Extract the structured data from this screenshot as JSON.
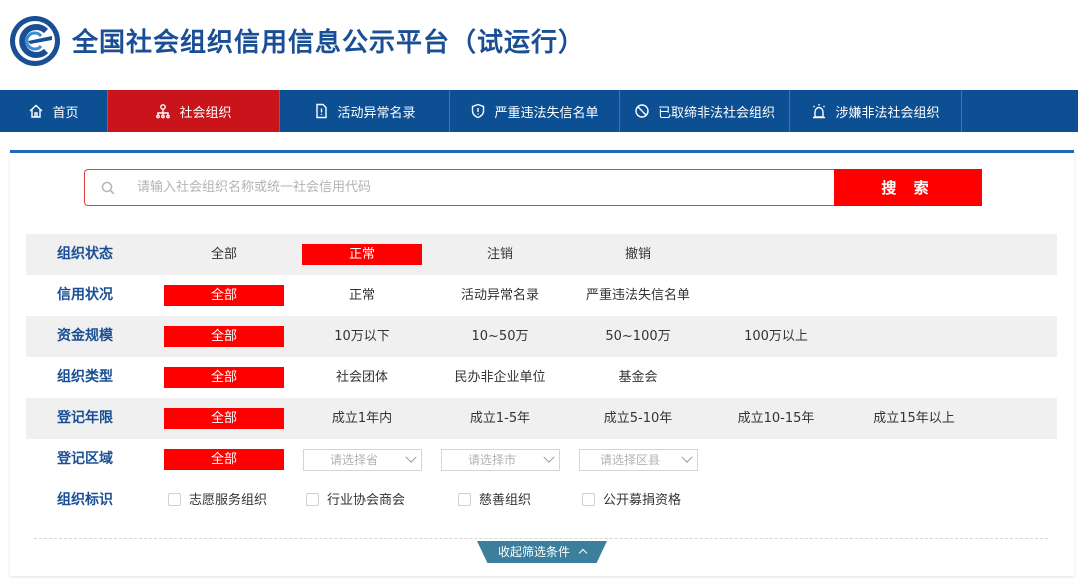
{
  "header": {
    "title": "全国社会组织信用信息公示平台（试运行）",
    "logo_icon": "platform-logo"
  },
  "nav": {
    "items": [
      {
        "label": "首页",
        "icon": "home-icon"
      },
      {
        "label": "社会组织",
        "icon": "org-tree-icon",
        "active": true
      },
      {
        "label": "活动异常名录",
        "icon": "document-alert-icon"
      },
      {
        "label": "严重违法失信名单",
        "icon": "shield-alert-icon"
      },
      {
        "label": "已取缔非法社会组织",
        "icon": "ban-icon"
      },
      {
        "label": "涉嫌非法社会组织",
        "icon": "alarm-icon"
      }
    ]
  },
  "search": {
    "placeholder": "请输入社会组织名称或统一社会信用代码",
    "button": "搜 索"
  },
  "filters": {
    "status": {
      "label": "组织状态",
      "options": [
        "全部",
        "正常",
        "注销",
        "撤销"
      ],
      "selected": "正常"
    },
    "credit": {
      "label": "信用状况",
      "options": [
        "全部",
        "正常",
        "活动异常名录",
        "严重违法失信名单"
      ],
      "selected": "全部"
    },
    "capital": {
      "label": "资金规模",
      "options": [
        "全部",
        "10万以下",
        "10~50万",
        "50~100万",
        "100万以上"
      ],
      "selected": "全部"
    },
    "type": {
      "label": "组织类型",
      "options": [
        "全部",
        "社会团体",
        "民办非企业单位",
        "基金会"
      ],
      "selected": "全部"
    },
    "years": {
      "label": "登记年限",
      "options": [
        "全部",
        "成立1年内",
        "成立1-5年",
        "成立5-10年",
        "成立10-15年",
        "成立15年以上"
      ],
      "selected": "全部"
    },
    "region": {
      "label": "登记区域",
      "all": "全部",
      "province": "请选择省",
      "city": "请选择市",
      "county": "请选择区县"
    },
    "marks": {
      "label": "组织标识",
      "options": [
        "志愿服务组织",
        "行业协会商会",
        "慈善组织",
        "公开募捐资格"
      ]
    }
  },
  "collapse_label": "收起筛选条件",
  "colors": {
    "nav_bg": "#0c4f93",
    "active_red": "#c8141a",
    "select_red": "#ff0000",
    "label_blue": "#1a4f95"
  }
}
